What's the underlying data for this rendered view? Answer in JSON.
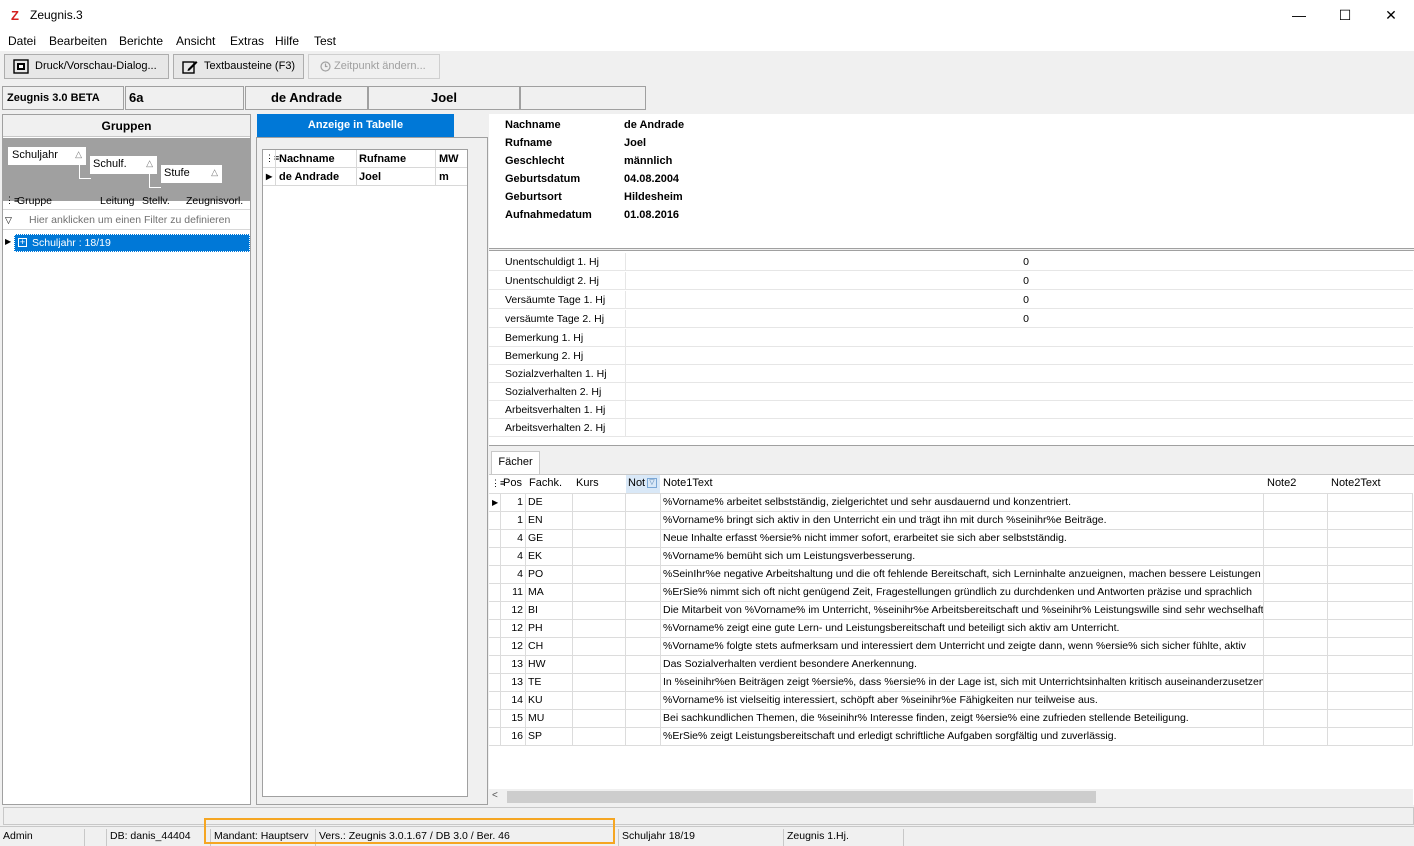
{
  "window": {
    "title": "Zeugnis.3",
    "logo": "Z",
    "minimize": "—",
    "maximize": "☐",
    "close": "✕"
  },
  "menu": [
    "Datei",
    "Bearbeiten",
    "Berichte",
    "Ansicht",
    "Extras",
    "Hilfe",
    "Test"
  ],
  "toolbar": {
    "print_label": "Druck/Vorschau-Dialog...",
    "text_label": "Textbausteine (F3)",
    "time_label": "Zeitpunkt ändern..."
  },
  "infobar": {
    "app": "Zeugnis 3.0 BETA",
    "class": "6a",
    "lastname": "de Andrade",
    "firstname": "Joel"
  },
  "groups": {
    "title": "Gruppen",
    "group_chips": [
      "Schuljahr",
      "Schulf.",
      "Stufe"
    ],
    "columns": [
      "Gruppe",
      "Leitung",
      "Stellv.",
      "Zeugnisvorl."
    ],
    "filter_hint": "Hier anklicken um einen Filter zu definieren",
    "row": "Schuljahr : 18/19"
  },
  "students": {
    "tab": "Anzeige in Tabelle",
    "columns": [
      "Nachname",
      "Rufname",
      "MW"
    ],
    "row": [
      "de Andrade",
      "Joel",
      "m"
    ]
  },
  "details": [
    {
      "label": "Nachname",
      "value": "de Andrade"
    },
    {
      "label": "Rufname",
      "value": "Joel"
    },
    {
      "label": "Geschlecht",
      "value": "männlich"
    },
    {
      "label": "Geburtsdatum",
      "value": "04.08.2004"
    },
    {
      "label": "Geburtsort",
      "value": "Hildesheim"
    },
    {
      "label": "Aufnahmedatum",
      "value": "01.08.2016"
    }
  ],
  "attendance": [
    {
      "label": "Unentschuldigt 1. Hj",
      "value": "0"
    },
    {
      "label": "Unentschuldigt 2. Hj",
      "value": "0"
    },
    {
      "label": "Versäumte Tage 1. Hj",
      "value": "0"
    },
    {
      "label": "versäumte Tage 2. Hj",
      "value": "0"
    },
    {
      "label": "Bemerkung 1. Hj",
      "value": ""
    },
    {
      "label": "Bemerkung 2. Hj",
      "value": ""
    },
    {
      "label": "Sozialzverhalten 1. Hj",
      "value": ""
    },
    {
      "label": "Sozialverhalten 2. Hj",
      "value": ""
    },
    {
      "label": "Arbeitsverhalten 1. Hj",
      "value": ""
    },
    {
      "label": "Arbeitsverhalten 2. Hj",
      "value": ""
    }
  ],
  "subjects": {
    "tab": "Fächer",
    "columns": [
      "Pos",
      "Fachk.",
      "Kurs",
      "Not",
      "Note1Text",
      "Note2",
      "Note2Text"
    ],
    "rows": [
      {
        "pos": "1",
        "fach": "DE",
        "text": "%Vorname% arbeitet selbstständig, zielgerichtet und sehr ausdauernd und konzentriert."
      },
      {
        "pos": "1",
        "fach": "EN",
        "text": "%Vorname% bringt sich aktiv in den Unterricht ein und trägt ihn mit durch %seinihr%e Beiträge."
      },
      {
        "pos": "4",
        "fach": "GE",
        "text": "Neue Inhalte erfasst %ersie% nicht immer sofort, erarbeitet sie sich aber selbstständig."
      },
      {
        "pos": "4",
        "fach": "EK",
        "text": "%Vorname% bemüht sich um Leistungsverbesserung."
      },
      {
        "pos": "4",
        "fach": "PO",
        "text": "%SeinIhr%e negative Arbeitshaltung und die oft fehlende Bereitschaft, sich Lerninhalte anzueignen, machen bessere Leistungen"
      },
      {
        "pos": "11",
        "fach": "MA",
        "text": "%ErSie% nimmt sich oft nicht genügend Zeit, Fragestellungen gründlich zu durchdenken und Antworten präzise und sprachlich"
      },
      {
        "pos": "12",
        "fach": "BI",
        "text": "Die Mitarbeit von %Vorname% im Unterricht, %seinihr%e Arbeitsbereitschaft und %seinihr% Leistungswille sind sehr wechselhaft"
      },
      {
        "pos": "12",
        "fach": "PH",
        "text": "%Vorname% zeigt eine gute Lern- und Leistungsbereitschaft und beteiligt sich aktiv am Unterricht."
      },
      {
        "pos": "12",
        "fach": "CH",
        "text": "%Vorname% folgte stets aufmerksam und interessiert dem Unterricht und zeigte dann, wenn %ersie% sich sicher fühlte, aktiv"
      },
      {
        "pos": "13",
        "fach": "HW",
        "text": "Das Sozialverhalten verdient besondere Anerkennung."
      },
      {
        "pos": "13",
        "fach": "TE",
        "text": "In %seinihr%en Beiträgen zeigt %ersie%, dass %ersie% in der Lage ist, sich mit Unterrichtsinhalten kritisch auseinanderzusetzen"
      },
      {
        "pos": "14",
        "fach": "KU",
        "text": "%Vorname% ist vielseitig interessiert, schöpft aber %seinihr%e Fähigkeiten nur teilweise aus."
      },
      {
        "pos": "15",
        "fach": "MU",
        "text": "Bei sachkundlichen Themen, die %seinihr% Interesse finden, zeigt %ersie% eine zufrieden stellende Beteiligung."
      },
      {
        "pos": "16",
        "fach": "SP",
        "text": "%ErSie% zeigt Leistungsbereitschaft und erledigt schriftliche Aufgaben sorgfältig und zuverlässig."
      }
    ]
  },
  "status": {
    "user": "Admin",
    "db": "DB: danis_44404",
    "mandant": "Mandant: Hauptserv",
    "version": "Vers.: Zeugnis 3.0.1.67 / DB 3.0 / Ber. 46",
    "schoolyear": "Schuljahr 18/19",
    "period": "Zeugnis 1.Hj."
  },
  "colors": {
    "selection": "#0078d7",
    "highlight_box": "#f5a623",
    "logo": "#d42020"
  }
}
